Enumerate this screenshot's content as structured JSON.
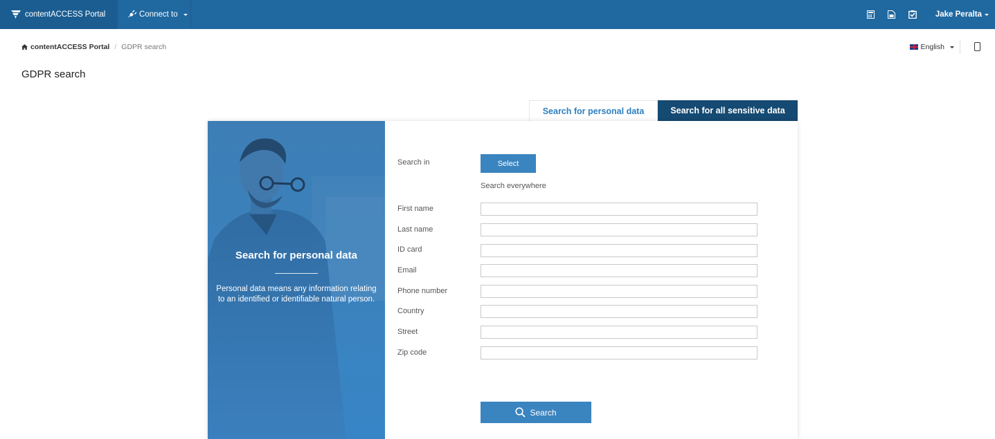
{
  "topbar": {
    "brand": "contentACCESS Portal",
    "connect_label": "Connect to",
    "icons": [
      "calculator-icon",
      "document-icon",
      "checklist-icon"
    ],
    "user_name": "Jake Peralta"
  },
  "breadcrumb": {
    "home_icon": "home-icon",
    "root": "contentACCESS Portal",
    "separator": "/",
    "current": "GDPR search"
  },
  "language": {
    "label": "English",
    "flag": "uk-flag-icon"
  },
  "page": {
    "title": "GDPR search"
  },
  "tabs": [
    {
      "label": "Search for personal data",
      "active": true
    },
    {
      "label": "Search for all sensitive data",
      "active": false
    }
  ],
  "hero": {
    "title": "Search for personal data",
    "description": "Personal data means any information relating to an identified or identifiable natural person."
  },
  "form": {
    "search_in_label": "Search in",
    "select_label": "Select",
    "search_note": "Search everywhere",
    "fields": [
      {
        "label": "First name",
        "value": ""
      },
      {
        "label": "Last name",
        "value": ""
      },
      {
        "label": "ID card",
        "value": ""
      },
      {
        "label": "Email",
        "value": ""
      },
      {
        "label": "Phone number",
        "value": ""
      },
      {
        "label": "Country",
        "value": ""
      },
      {
        "label": "Street",
        "value": ""
      },
      {
        "label": "Zip code",
        "value": ""
      }
    ],
    "search_label": "Search"
  },
  "colors": {
    "topbar": "#2068a0",
    "brand_bg": "#1b5d91",
    "accent": "#3a84c0",
    "tab_active_text": "#2e7fc1",
    "tab_inactive_bg": "#154a72"
  }
}
